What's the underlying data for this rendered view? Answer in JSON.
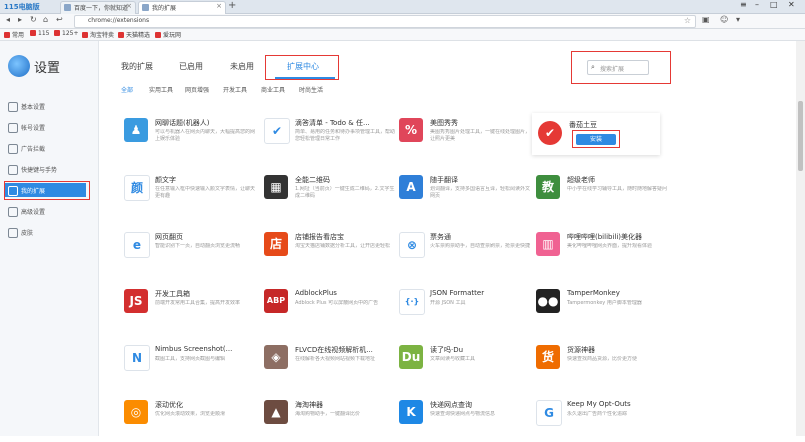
{
  "browser": {
    "brand": "115电脑版",
    "tabs": [
      {
        "title": "百度一下，你就知道",
        "active": false
      },
      {
        "title": "我的扩展",
        "active": true
      }
    ],
    "new_tab": "+",
    "address": "chrome://extensions",
    "bookmarks": [
      "常用",
      "115",
      "125+",
      "淘宝特卖",
      "天猫精选",
      "爱玩网"
    ]
  },
  "sidebar": {
    "title": "设置",
    "items": [
      {
        "label": "基本设置",
        "icon": "gear-icon"
      },
      {
        "label": "帐号设置",
        "icon": "user-icon"
      },
      {
        "label": "广告拦截",
        "icon": "shield-icon"
      },
      {
        "label": "快捷键与手势",
        "icon": "keyboard-icon"
      },
      {
        "label": "我的扩展",
        "icon": "puzzle-icon",
        "active": true
      },
      {
        "label": "高级设置",
        "icon": "sliders-icon"
      },
      {
        "label": "皮肤",
        "icon": "shirt-icon"
      }
    ]
  },
  "main": {
    "tabs": [
      {
        "label": "我的扩展"
      },
      {
        "label": "已启用"
      },
      {
        "label": "未启用"
      },
      {
        "label": "扩展中心",
        "active": true
      }
    ],
    "search_placeholder": "搜索扩展",
    "categories": [
      "全部",
      "实用工具",
      "网页增强",
      "开发工具",
      "商业工具",
      "时尚生活"
    ],
    "install_label": "安装",
    "extensions": [
      {
        "name": "网聊话题(机器人)",
        "desc": "可以与机器人在网页内聊天，大幅提高您的网上娱乐体验",
        "color": "#3a9be0",
        "glyph": "♟"
      },
      {
        "name": "滴答清单 - Todo & 任...",
        "desc": "简单、易用的任务和待办事项管理工具，帮助您轻松管理日常工作",
        "color": "#ffffff",
        "glyph": "✔"
      },
      {
        "name": "美图秀秀",
        "desc": "美图秀秀图片处理工具，一键在线处理图片，让照片更美",
        "color": "#e0465a",
        "glyph": "%"
      },
      {
        "name": "番茄土豆",
        "desc": "",
        "color": "#e53935",
        "glyph": "✔",
        "highlight": true
      },
      {
        "name": "颜文字",
        "desc": "在任意输入框中快速输入颜文字表情，让聊天更有趣",
        "color": "#ffffff",
        "glyph": "颜"
      },
      {
        "name": "全能二维码",
        "desc": "1.网址（当前页）一键生成二维码，2.文字生成二维码",
        "color": "#333333",
        "glyph": "▦"
      },
      {
        "name": "随手翻译",
        "desc": "划词翻译，支持多国语言互译，轻松阅读外文网页",
        "color": "#2f7fd8",
        "glyph": "A"
      },
      {
        "name": "超级老师",
        "desc": "中小学在线学习辅导工具，随时随地解答疑问",
        "color": "#3e8e3e",
        "glyph": "教"
      },
      {
        "name": "网页翻页",
        "desc": "智能识别下一页，自动翻页浏览更流畅",
        "color": "#ffffff",
        "glyph": "e"
      },
      {
        "name": "店铺报告看店宝",
        "desc": "淘宝天猫店铺数据分析工具，让开店更轻松",
        "color": "#e64a19",
        "glyph": "店"
      },
      {
        "name": "票务通",
        "desc": "火车票购票助手，自动查票刷票，抢票更快捷",
        "color": "#ffffff",
        "glyph": "⊗"
      },
      {
        "name": "哔哩哔哩(bilibili)美化器",
        "desc": "美化哔哩哔哩网页界面，提升观看体验",
        "color": "#f06292",
        "glyph": "▥"
      },
      {
        "name": "开发工具箱",
        "desc": "前端开发常用工具合集，提高开发效率",
        "color": "#d32f2f",
        "glyph": "JS"
      },
      {
        "name": "AdblockPlus",
        "desc": "Adblock Plus 可以屏蔽网页中的广告",
        "color": "#c62828",
        "glyph": "ABP"
      },
      {
        "name": "JSON Formatter",
        "desc": "开源 JSON 工具",
        "color": "#ffffff",
        "glyph": "{·}"
      },
      {
        "name": "TamperMonkey",
        "desc": "Tampermonkey 用户脚本管理器",
        "color": "#222222",
        "glyph": "●●"
      },
      {
        "name": "Nimbus Screenshot(...",
        "desc": "截图工具，支持网页截图与编辑",
        "color": "#ffffff",
        "glyph": "N"
      },
      {
        "name": "FLVCD在线视频解析机...",
        "desc": "在线解析各大视频网站视频下载地址",
        "color": "#8d6e63",
        "glyph": "◈"
      },
      {
        "name": "读了吗·Du",
        "desc": "文章阅读与收藏工具",
        "color": "#7cb342",
        "glyph": "Du"
      },
      {
        "name": "货源神器",
        "desc": "快速查找商品货源，比价更方便",
        "color": "#ef6c00",
        "glyph": "货"
      },
      {
        "name": "滚动优化",
        "desc": "优化网页滚动效果，浏览更顺滑",
        "color": "#fb8c00",
        "glyph": "◎"
      },
      {
        "name": "海淘神器",
        "desc": "海淘购物助手，一键翻译比价",
        "color": "#6d4c41",
        "glyph": "▲"
      },
      {
        "name": "快递网点查询",
        "desc": "快速查询快递网点与物流信息",
        "color": "#1e88e5",
        "glyph": "K"
      },
      {
        "name": "Keep My Opt-Outs",
        "desc": "永久退出广告商个性化追踪",
        "color": "#ffffff",
        "glyph": "G"
      }
    ]
  }
}
